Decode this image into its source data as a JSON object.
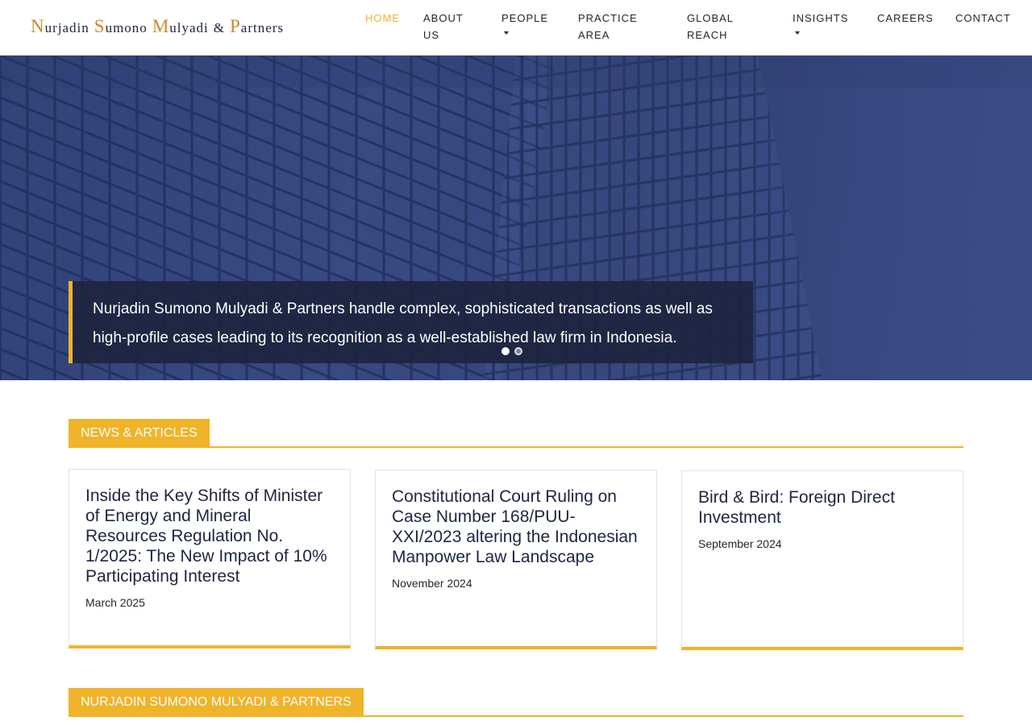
{
  "header": {
    "logo": {
      "text": "Nurjadin Sumono Mulyadi & Partners",
      "words": [
        {
          "cap": "N",
          "rest": "urjadin"
        },
        {
          "cap": "S",
          "rest": "umono"
        },
        {
          "cap": "M",
          "rest": "ulyadi"
        },
        {
          "cap": "",
          "rest": "&"
        },
        {
          "cap": "P",
          "rest": "artners"
        }
      ]
    },
    "nav": {
      "home": "HOME",
      "about_l1": "ABOUT",
      "about_l2": "US",
      "people": "PEOPLE",
      "practice_l1": "PRACTICE",
      "practice_l2": "AREA",
      "global_l1": "GLOBAL",
      "global_l2": "REACH",
      "insights": "INSIGHTS",
      "careers": "CAREERS",
      "contact": "CONTACT"
    }
  },
  "hero": {
    "caption_line1": "Nurjadin Sumono Mulyadi & Partners handle complex, sophisticated transactions as well as",
    "caption_line2": "high-profile cases leading to its recognition as a well-established law firm in Indonesia.",
    "slides_total": 2,
    "active_slide": 1
  },
  "news": {
    "heading": "NEWS & ARTICLES",
    "articles": [
      {
        "title_lines": [
          "Inside the Key Shifts of Minister",
          "of Energy and Mineral",
          "Resources Regulation No.",
          "1/2025: The New Impact of 10%",
          "Participating Interest"
        ],
        "date": "March 2025"
      },
      {
        "title_lines": [
          "Constitutional Court Ruling on",
          "Case Number 168/PUU-",
          "XXI/2023 altering the Indonesian",
          "Manpower Law Landscape"
        ],
        "date": "November 2024"
      },
      {
        "title_lines": [
          "Bird & Bird: Foreign Direct",
          "Investment"
        ],
        "date": "September 2024"
      }
    ]
  },
  "firm_section": {
    "heading": "NURJADIN SUMONO MULYADI & PARTNERS"
  },
  "colors": {
    "accent": "#f0b32a",
    "navy": "#1e2540",
    "hero_blue": "#34467c"
  }
}
